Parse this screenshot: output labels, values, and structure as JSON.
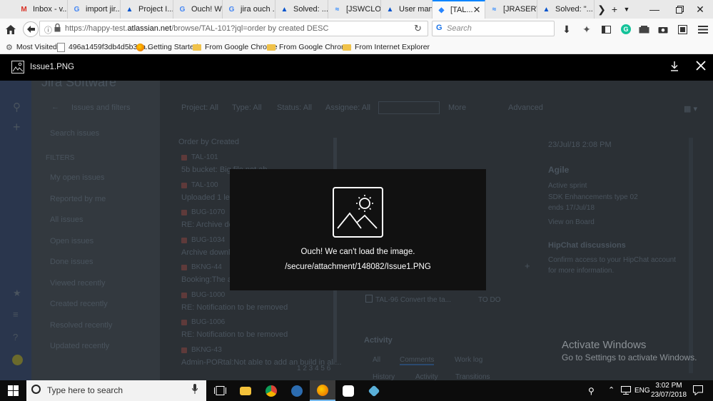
{
  "browser": {
    "tabs": [
      {
        "label": "Inbox - v...",
        "icon": "gmail-icon",
        "color": "#d93025"
      },
      {
        "label": "import jir...",
        "icon": "google-icon",
        "color": "#4285f4"
      },
      {
        "label": "Project I...",
        "icon": "atlassian-icon",
        "color": "#0052cc"
      },
      {
        "label": "Ouch! W...",
        "icon": "google-icon",
        "color": "#4285f4"
      },
      {
        "label": "jira ouch ...",
        "icon": "google-icon",
        "color": "#4285f4"
      },
      {
        "label": "Solved: ...",
        "icon": "atlassian-icon",
        "color": "#0052cc"
      },
      {
        "label": "[JSWCLO...",
        "icon": "confluence-icon",
        "color": "#2684ff"
      },
      {
        "label": "User man...",
        "icon": "atlassian-icon",
        "color": "#0052cc"
      },
      {
        "label": "[TAL...",
        "icon": "jira-icon",
        "color": "#2684ff",
        "active": true
      },
      {
        "label": "[JRASERV...",
        "icon": "confluence-icon",
        "color": "#2684ff"
      },
      {
        "label": "Solved: \"...",
        "icon": "atlassian-icon",
        "color": "#0052cc"
      }
    ],
    "url_prefix": "https://happy-test.",
    "url_domain": "atlassian.net",
    "url_rest": "/browse/TAL-101?jql=order by created DESC",
    "search_placeholder": "Search",
    "bookmarks": [
      {
        "label": "Most Visited",
        "icon": "gear-icon"
      },
      {
        "label": "496a1459f3db4d5b37a...",
        "icon": "page-icon"
      },
      {
        "label": "Getting Started",
        "icon": "firefox-icon"
      },
      {
        "label": "From Google Chrome",
        "icon": "folder-icon"
      },
      {
        "label": "From Google Chrome",
        "icon": "folder-icon"
      },
      {
        "label": "From Internet Explorer",
        "icon": "folder-icon"
      }
    ]
  },
  "viewer": {
    "filename": "Issue1.PNG",
    "error_title": "Ouch! We can't load the image.",
    "error_path": "/secure/attachment/148082/Issue1.PNG"
  },
  "background": {
    "app_title": "Jira Software",
    "search_link": "Issues and filters",
    "search_issues": "Search issues",
    "filters_heading": "FILTERS",
    "filters": [
      "My open issues",
      "Reported by me",
      "All issues",
      "Open issues",
      "Done issues",
      "Viewed recently",
      "Created recently",
      "Resolved recently",
      "Updated recently"
    ],
    "toolbar": [
      "Project: All",
      "Type: All",
      "Status: All",
      "Assignee: All",
      "More",
      "Advanced"
    ],
    "order_label": "Order by Created",
    "issues": [
      {
        "key": "TAL-101",
        "summary": "5b bucket: Big file not ab..."
      },
      {
        "key": "TAL-100",
        "summary": "Uploaded 1 le..."
      },
      {
        "key": "BUG-1070",
        "summary": "RE: Archive downl..."
      },
      {
        "key": "BUG-1034",
        "summary": "Archive downloa..."
      },
      {
        "key": "BKNG-44",
        "summary": "Booking:The an..."
      },
      {
        "key": "BUG-1000",
        "summary": "RE: Notification to be removed"
      },
      {
        "key": "BUG-1006",
        "summary": "RE: Notification to be removed"
      },
      {
        "key": "BKNG-43",
        "summary": "Admin-PORtal:Not able to add an build in all..."
      }
    ],
    "pagination": "1 2 3 4 5 6",
    "right_date": "23/Jul/18 2:08 PM",
    "agile_heading": "Agile",
    "agile_lines": [
      "Active sprint",
      "SDK Enhancements type 02",
      "ends 17/Jul/18",
      "View on Board"
    ],
    "hipchat_heading": "HipChat discussions",
    "hipchat_text": [
      "Confirm access to your HipChat account",
      "for more information."
    ],
    "activity_heading": "Activity",
    "activity_tabs": [
      "All",
      "Comments",
      "Work log"
    ],
    "activity_tabs2": [
      "History",
      "Activity",
      "Transitions"
    ],
    "linked_issue": "TAL-96 Convert the ta...",
    "linked_status": "TO DO"
  },
  "watermark": {
    "title": "Activate Windows",
    "subtitle": "Go to Settings to activate Windows."
  },
  "taskbar": {
    "search_placeholder": "Type here to search",
    "time": "3:02 PM",
    "date": "23/07/2018",
    "lang": "ENG"
  }
}
